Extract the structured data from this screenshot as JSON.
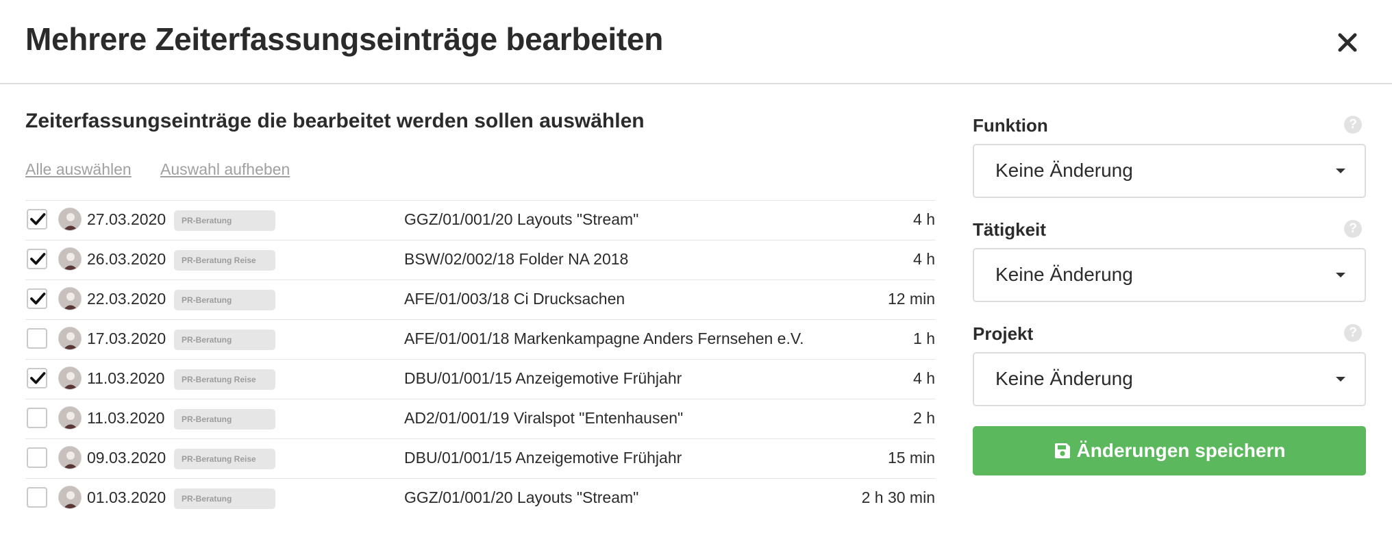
{
  "dialog": {
    "title": "Mehrere Zeiterfassungseinträge bearbeiten",
    "close_icon": "close-icon"
  },
  "selection": {
    "heading": "Zeiterfassungseinträge die bearbeitet werden sollen auswählen",
    "select_all": "Alle auswählen",
    "deselect": "Auswahl aufheben"
  },
  "entries": [
    {
      "checked": true,
      "date": "27.03.2020",
      "tag": "PR-Beratung",
      "project": "GGZ/01/001/20 Layouts \"Stream\"",
      "duration": "4 h"
    },
    {
      "checked": true,
      "date": "26.03.2020",
      "tag": "PR-Beratung Reise",
      "project": "BSW/02/002/18 Folder NA 2018",
      "duration": "4 h"
    },
    {
      "checked": true,
      "date": "22.03.2020",
      "tag": "PR-Beratung",
      "project": "AFE/01/003/18 Ci Drucksachen",
      "duration": "12 min"
    },
    {
      "checked": false,
      "date": "17.03.2020",
      "tag": "PR-Beratung",
      "project": "AFE/01/001/18 Markenkampagne Anders Fernsehen e.V.",
      "duration": "1 h"
    },
    {
      "checked": true,
      "date": "11.03.2020",
      "tag": "PR-Beratung Reise",
      "project": "DBU/01/001/15 Anzeigemotive Frühjahr",
      "duration": "4 h"
    },
    {
      "checked": false,
      "date": "11.03.2020",
      "tag": "PR-Beratung",
      "project": "AD2/01/001/19 Viralspot \"Entenhausen\"",
      "duration": "2 h"
    },
    {
      "checked": false,
      "date": "09.03.2020",
      "tag": "PR-Beratung Reise",
      "project": "DBU/01/001/15 Anzeigemotive Frühjahr",
      "duration": "15 min"
    },
    {
      "checked": false,
      "date": "01.03.2020",
      "tag": "PR-Beratung",
      "project": "GGZ/01/001/20 Layouts \"Stream\"",
      "duration": "2 h 30 min"
    }
  ],
  "form": {
    "funktion": {
      "label": "Funktion",
      "value": "Keine Änderung",
      "help": "?"
    },
    "taetigkeit": {
      "label": "Tätigkeit",
      "value": "Keine Änderung",
      "help": "?"
    },
    "projekt": {
      "label": "Projekt",
      "value": "Keine Änderung",
      "help": "?"
    },
    "save_label": "Änderungen speichern",
    "save_icon": "floppy-disk-icon",
    "save_color": "#5cb85c"
  }
}
